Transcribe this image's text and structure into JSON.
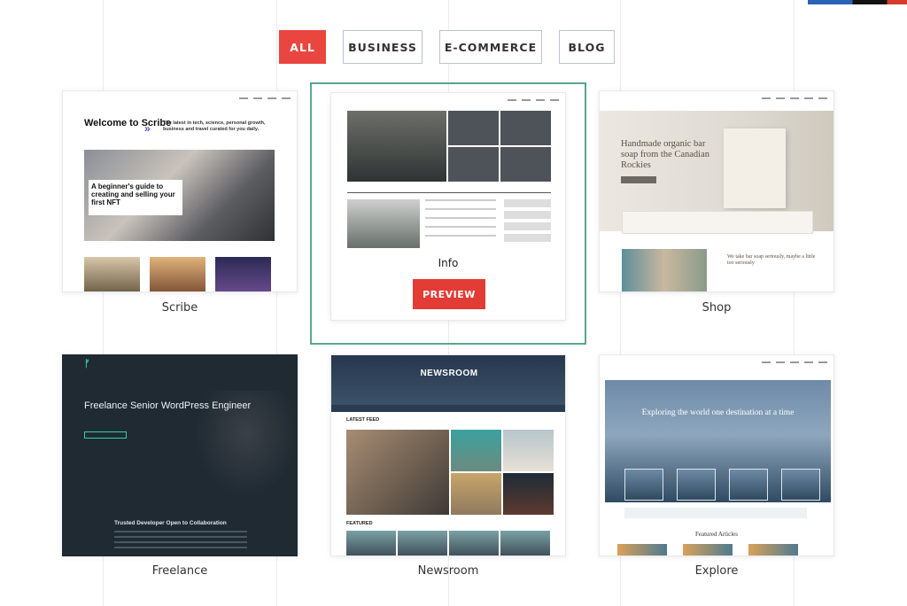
{
  "filters": {
    "items": [
      {
        "label": "ALL",
        "active": true
      },
      {
        "label": "BUSINESS",
        "active": false
      },
      {
        "label": "E-COMMERCE",
        "active": false
      },
      {
        "label": "BLOG",
        "active": false
      }
    ]
  },
  "themes": {
    "scribe": {
      "name": "Scribe",
      "hero_title": "Welcome to Scribe",
      "tagline": "The latest in tech, science, personal growth, business and travel curated for you daily.",
      "featured_title": "A beginner's guide to creating and selling your first NFT"
    },
    "info": {
      "name": "Info",
      "preview_label": "PREVIEW"
    },
    "shop": {
      "name": "Shop",
      "hero_title": "Handmade organic bar soap from the Canadian Rockies",
      "secondary_text": "We take bar soap seriously, maybe a little too seriously"
    },
    "freelance": {
      "name": "Freelance",
      "hero_title": "Freelance Senior WordPress Engineer",
      "subtitle": "Trusted Developer Open to Collaboration"
    },
    "newsroom": {
      "name": "Newsroom",
      "banner": "NEWSROOM",
      "section_latest": "LATEST FEED",
      "section_featured": "FEATURED"
    },
    "explore": {
      "name": "Explore",
      "hero_title": "Exploring the world one destination at a time",
      "featured_label": "Featured Articles"
    }
  }
}
